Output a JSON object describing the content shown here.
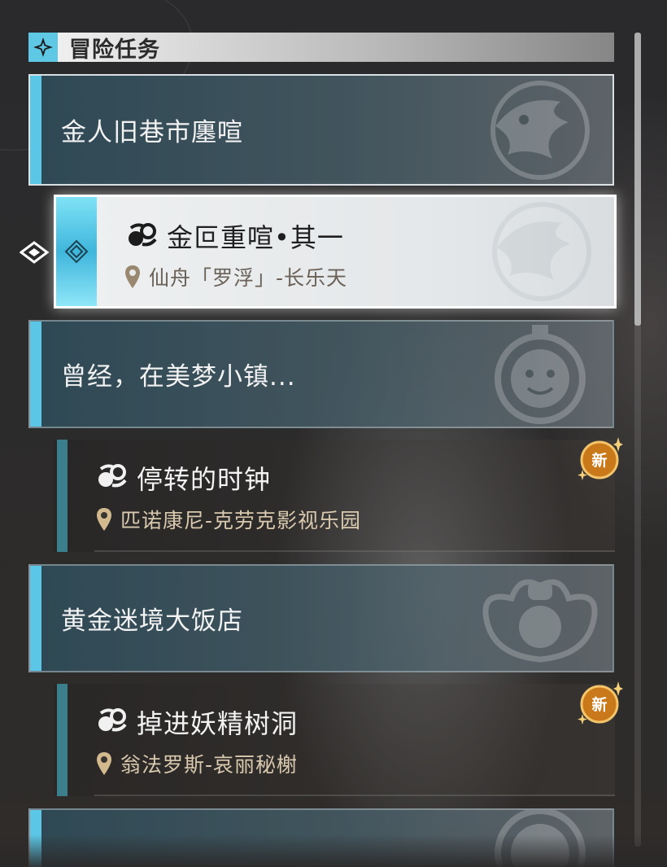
{
  "header": {
    "title": "冒险任务",
    "icon": "sparkle-icon"
  },
  "groups": [
    {
      "title": "金人旧巷市廛喧",
      "emblem": "bird-emblem-icon"
    },
    {
      "title": "曾经，在美梦小镇...",
      "emblem": "clockie-emblem-icon"
    },
    {
      "title": "黄金迷境大饭店",
      "emblem": "chef-emblem-icon"
    },
    {
      "title": "",
      "emblem": "clockie-emblem-icon"
    }
  ],
  "quests": [
    {
      "name": "金叵重喧•其一",
      "location": "仙舟「罗浮」-长乐天",
      "selected": true,
      "is_new": false
    },
    {
      "name": "停转的时钟",
      "location": "匹诺康尼-克劳克影视乐园",
      "selected": false,
      "is_new": true
    },
    {
      "name": "掉进妖精树洞",
      "location": "翁法罗斯-哀丽秘榭",
      "selected": false,
      "is_new": true
    }
  ],
  "badge_label": "新",
  "colors": {
    "accent_cyan": "#5cc6e6",
    "quest_bar": "#3b7f8c",
    "badge_orange": "#c9781a"
  }
}
